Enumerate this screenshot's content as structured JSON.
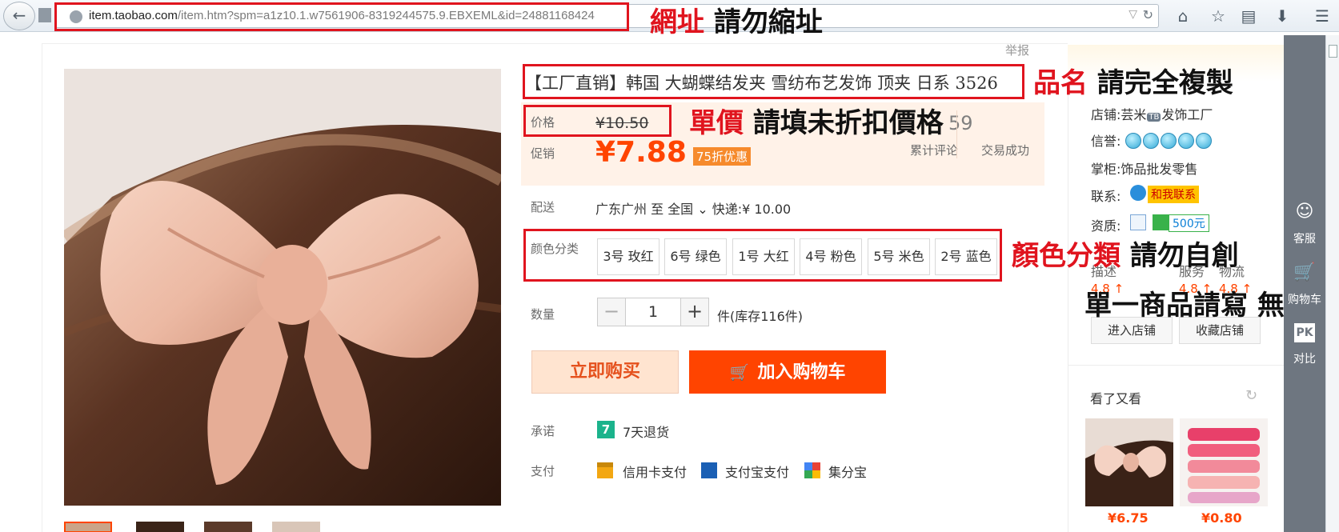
{
  "browser": {
    "url_host": "item.taobao.com",
    "url_path": "/item.htm?spm=a1z10.1.w7561906-8319244575.9.EBXEML&id=24881168424"
  },
  "page": {
    "report_link": "举报",
    "title": "【工厂直销】韩国 大蝴蝶结发夹 雪纺布艺发饰 顶夹 日系 3526",
    "price_label": "价格",
    "original_price": "¥10.50",
    "promo_label": "促销",
    "promo_price": "¥7.88",
    "discount_badge": "75折优惠",
    "review_count": "59",
    "review_label": "累计评论",
    "deal_label": "交易成功",
    "shipping_label": "配送",
    "shipping_value": "广东广州  至 全国 ⌄ 快递:¥ 10.00",
    "color_label": "颜色分类",
    "colors": [
      "3号 玫红",
      "6号 绿色",
      "1号 大红",
      "4号 粉色",
      "5号 米色",
      "2号 蓝色"
    ],
    "quantity_label": "数量",
    "quantity_value": "1",
    "quantity_minus": "−",
    "quantity_plus": "+",
    "stock_text": "件(库存116件)",
    "buy_now": "立即购买",
    "add_to_cart": "加入购物车",
    "promise_label": "承诺",
    "promise_text": "7天退货",
    "promise_icon_text": "7",
    "pay_label": "支付",
    "pay_methods": [
      "信用卡支付",
      "支付宝支付",
      "集分宝"
    ]
  },
  "shop": {
    "shop_label": "店铺:",
    "shop_name": "芸米",
    "shop_tag": "TB",
    "shop_name_suffix": "发饰工厂",
    "credit_label": "信誉:",
    "keeper_label": "掌柜:",
    "keeper_value": "饰品批发零售",
    "contact_label": "联系:",
    "contact_button": "和我联系",
    "qualify_label": "资质:",
    "deposit_badge": "500元",
    "dsr_heads": [
      "描述",
      "服务",
      "物流"
    ],
    "dsr_values": [
      "4.8 ↑",
      "4.8 ↑",
      "4.8 ↑"
    ],
    "enter_shop": "进入店铺",
    "fav_shop": "收藏店铺"
  },
  "see_also": {
    "title": "看了又看",
    "prices": [
      "¥6.75",
      "¥0.80"
    ]
  },
  "util_bar": {
    "service": "客服",
    "cart": "购物车",
    "compare_icon": "PK",
    "compare": "对比"
  },
  "annotations": {
    "url": {
      "red": "網址",
      "black": "請勿縮址"
    },
    "title": {
      "red": "品名",
      "black": "請完全複製"
    },
    "price": {
      "red": "單價",
      "black": "請填未折扣價格"
    },
    "color": {
      "red": "顏色分類",
      "black": "請勿自創"
    },
    "single": {
      "black": "單一商品請寫 無"
    }
  },
  "colors": {
    "accent": "#ff4400",
    "annotation_red": "#e0141e",
    "price_panel_bg": "#fff2e8"
  }
}
